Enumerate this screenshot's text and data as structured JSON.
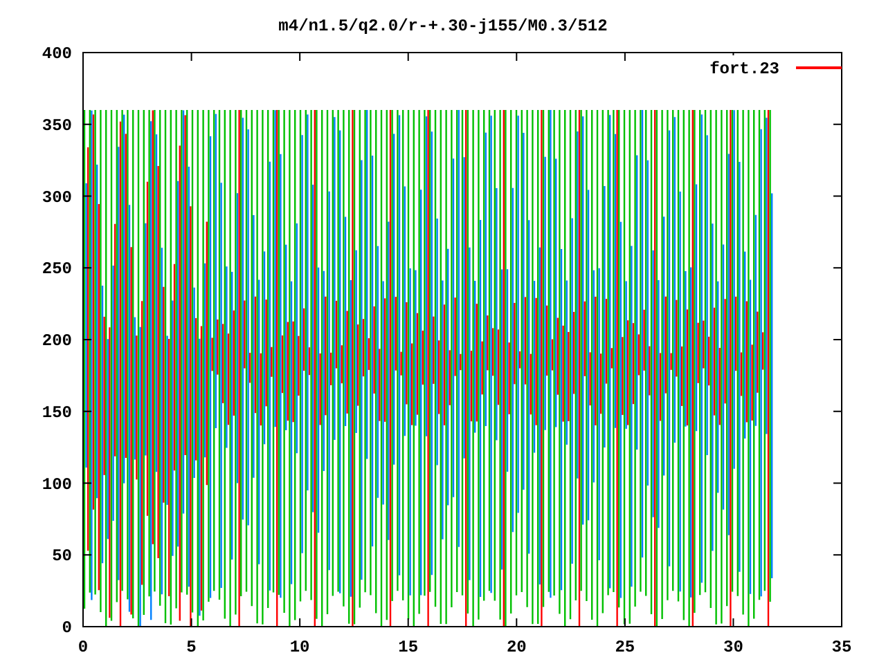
{
  "title": "m4/n1.5/q2.0/r-+.30-j155/M0.3/512",
  "legend": {
    "label": "fort.23",
    "color": "#ff0000"
  },
  "x_axis": {
    "ticks": [
      "0",
      "5",
      "10",
      "15",
      "20",
      "25",
      "30",
      "35"
    ]
  },
  "y_axis": {
    "ticks": [
      "400",
      "350",
      "300",
      "250",
      "200",
      "150",
      "100",
      "50",
      "0"
    ]
  }
}
